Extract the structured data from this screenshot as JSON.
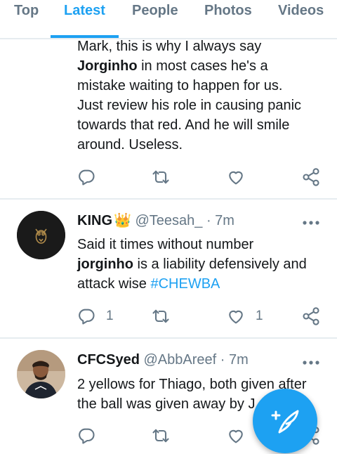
{
  "tabs": [
    {
      "label": "Top"
    },
    {
      "label": "Latest"
    },
    {
      "label": "People"
    },
    {
      "label": "Photos"
    },
    {
      "label": "Videos"
    }
  ],
  "tweets": [
    {
      "text_lines": [
        {
          "parts": [
            {
              "t": "Mark, this is why I always say",
              "s": "normal"
            }
          ]
        },
        {
          "parts": [
            {
              "t": "Jorginho",
              "s": "bold"
            },
            {
              "t": " in most cases he's a",
              "s": "normal"
            }
          ]
        },
        {
          "parts": [
            {
              "t": "mistake waiting to happen for us.",
              "s": "normal"
            }
          ]
        },
        {
          "parts": [
            {
              "t": "Just review his role in causing panic",
              "s": "normal"
            }
          ]
        },
        {
          "parts": [
            {
              "t": "towards that red. And he will smile",
              "s": "normal"
            }
          ]
        },
        {
          "parts": [
            {
              "t": "around. Useless.",
              "s": "normal"
            }
          ]
        }
      ],
      "reply_count": "",
      "like_count": ""
    },
    {
      "name": "KING",
      "name_emoji": "👑",
      "handle": "@Teesah_",
      "time": "· 7m",
      "avatar_icon": "owl-logo-icon",
      "text_lines": [
        {
          "parts": [
            {
              "t": "Said it times without number",
              "s": "normal"
            }
          ]
        },
        {
          "parts": [
            {
              "t": "jorginho",
              "s": "bold"
            },
            {
              "t": " is a liability defensively and",
              "s": "normal"
            }
          ]
        },
        {
          "parts": [
            {
              "t": "attack wise ",
              "s": "normal"
            },
            {
              "t": "#CHEWBA",
              "s": "hashtag"
            }
          ]
        }
      ],
      "reply_count": "1",
      "like_count": "1"
    },
    {
      "name": "CFCSyed",
      "handle": "@AbbAreef",
      "time": "· 7m",
      "avatar_icon": "user-photo-icon",
      "text_lines": [
        {
          "parts": [
            {
              "t": "2 yellows for Thiago, both given after",
              "s": "normal"
            }
          ]
        },
        {
          "parts": [
            {
              "t": "the ball was given away by J",
              "s": "normal"
            }
          ]
        }
      ],
      "reply_count": "",
      "like_count": ""
    }
  ],
  "colors": {
    "accent": "#1da1f2",
    "secondary_text": "#657786",
    "divider": "#e6ecf0"
  },
  "fab": {
    "icon": "compose-tweet-icon"
  }
}
